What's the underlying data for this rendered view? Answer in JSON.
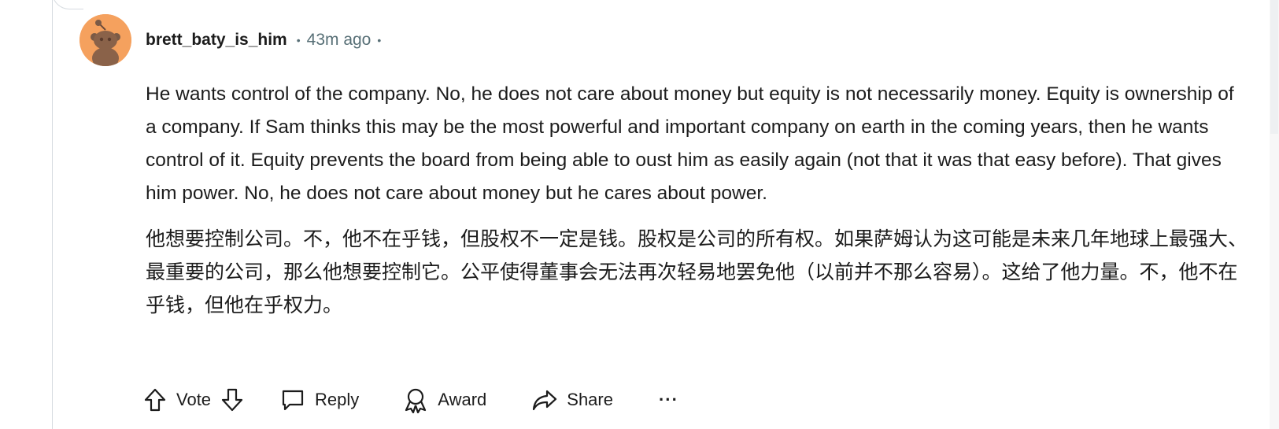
{
  "comment": {
    "username": "brett_baty_is_him",
    "time_ago": "43m ago",
    "separator": "•",
    "body_en": "He wants control of the company. No, he does not care about money but equity is not necessarily money. Equity is ownership of a company. If Sam thinks this may be the most powerful and important company on earth in the coming years, then he wants control of it. Equity prevents the board from being able to oust him as easily again (not that it was that easy before). That gives him power. No, he does not care about money but he cares about power.",
    "body_zh": "他想要控制公司。不，他不在乎钱，但股权不一定是钱。股权是公司的所有权。如果萨姆认为这可能是未来几年地球上最强大、最重要的公司，那么他想要控制它。公平使得董事会无法再次轻易地罢免他（以前并不那么容易）。这给了他力量。不，他不在乎钱，但他在乎权力。"
  },
  "actions": {
    "vote_label": "Vote",
    "reply_label": "Reply",
    "award_label": "Award",
    "share_label": "Share",
    "more_label": "···"
  },
  "colors": {
    "avatar_bg": "#f5a15e",
    "meta_text": "#576f76",
    "thread_line": "#d6dbe0"
  }
}
